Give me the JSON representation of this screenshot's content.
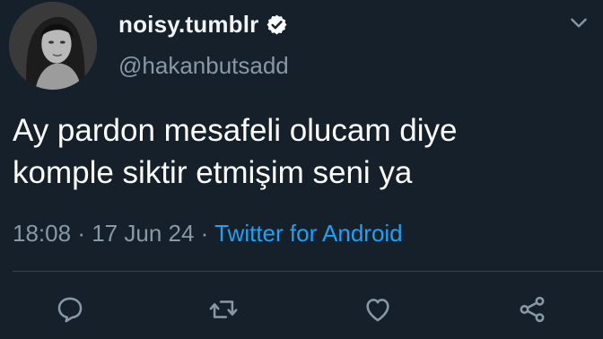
{
  "tweet": {
    "display_name": "noisy.tumblr",
    "verified": true,
    "handle": "@hakanbutsadd",
    "text_lines": [
      "Ay pardon mesafeli olucam diye",
      "komple siktir etmişim seni ya"
    ],
    "time": "18:08",
    "separator": "·",
    "date": "17 Jun 24",
    "source": "Twitter for Android"
  },
  "icons": {
    "avatar": "profile-photo",
    "verified": "verified-badge-icon",
    "more": "chevron-down-icon",
    "reply": "reply-icon",
    "retweet": "retweet-icon",
    "like": "like-icon",
    "share": "share-icon"
  },
  "colors": {
    "background": "#15202b",
    "secondary_text": "#8899a6",
    "link": "#1da1f2",
    "divider": "#38444d"
  }
}
